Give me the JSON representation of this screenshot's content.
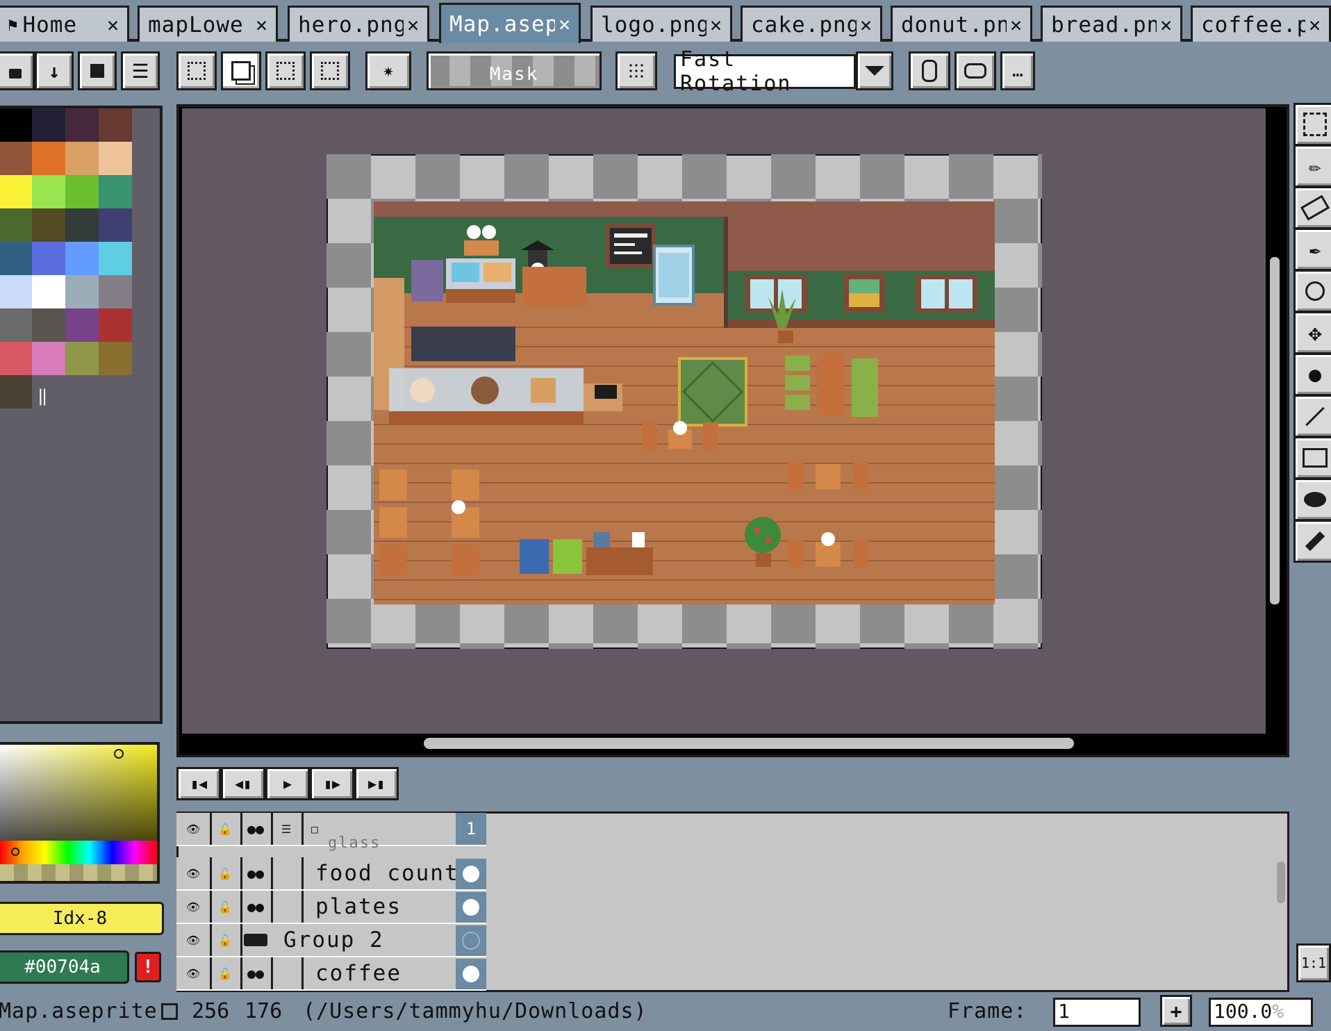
{
  "tabs": [
    {
      "label": "Home",
      "active": false
    },
    {
      "label": "mapLowe",
      "active": false
    },
    {
      "label": "hero.png",
      "active": false
    },
    {
      "label": "Map.asep",
      "active": true
    },
    {
      "label": "logo.png",
      "active": false
    },
    {
      "label": "cake.png",
      "active": false
    },
    {
      "label": "donut.pn",
      "active": false
    },
    {
      "label": "bread.pn",
      "active": false
    },
    {
      "label": "coffee.pı",
      "active": false
    }
  ],
  "toolbar": {
    "mask_label": "Mask",
    "rotation_algorithm": "Fast Rotation"
  },
  "palette": {
    "colors": [
      "#000000",
      "#222034",
      "#45283c",
      "#663931",
      "#8f563b",
      "#df7126",
      "#d9a066",
      "#eec39a",
      "#fbf236",
      "#99e550",
      "#6abe30",
      "#37946e",
      "#4b692f",
      "#524b24",
      "#323c39",
      "#3f3f74",
      "#306082",
      "#5b6ee1",
      "#639bff",
      "#5fcde4",
      "#cbdbfc",
      "#ffffff",
      "#9badb7",
      "#847e87",
      "#696a6a",
      "#595652",
      "#76428a",
      "#ac3232",
      "#d95763",
      "#d77bba",
      "#8f974a",
      "#8a6f30",
      "#4a4034"
    ]
  },
  "color_picker": {
    "index_label": "Idx-8",
    "hex_value": "#00704a"
  },
  "timeline": {
    "frame_number": "1",
    "layers": [
      {
        "name": "glass",
        "type": "layer"
      },
      {
        "name": "food counte",
        "type": "layer"
      },
      {
        "name": "plates",
        "type": "layer"
      },
      {
        "name": "Group 2",
        "type": "group"
      },
      {
        "name": "coffee",
        "type": "layer"
      }
    ]
  },
  "status": {
    "filename": "Map.aseprite",
    "sprite_width": "256",
    "sprite_height": "176",
    "path": "(/Users/tammyhu/Downloads)",
    "frame_label": "Frame:",
    "frame_value": "1",
    "zoom_value": "100.0",
    "zoom_unit": "%"
  },
  "colors": {
    "ui_background": "#7e8fa0",
    "canvas_background": "#625862",
    "floor": "#b9784c",
    "wall_green": "#3a6a44",
    "wall_brown": "#8f5a4a",
    "active_tab": "#6b8aa3"
  }
}
